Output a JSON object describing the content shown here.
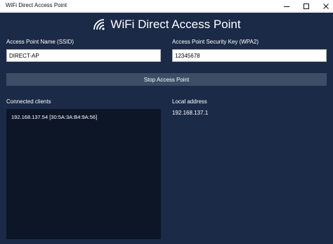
{
  "window": {
    "title": "WiFi Direct Access Point",
    "controls": [
      "minimize-icon",
      "maximize-icon",
      "close-icon"
    ]
  },
  "app": {
    "heading": "WiFi Direct Access Point",
    "heading_icon": "wifi-icon",
    "ssid": {
      "label": "Access Point Name (SSID)",
      "value": "DIRECT-AP"
    },
    "key": {
      "label": "Access Point Security Key (WPA2)",
      "value": "12345678"
    },
    "stop_button": "Stop Access Point",
    "clients": {
      "label": "Connected clients",
      "items": [
        "192.168.137.54 [30:5A:3A:B4:9A:56]"
      ]
    },
    "local": {
      "label": "Local address",
      "value": "192.168.137.1"
    }
  },
  "colors": {
    "background": "#1b2a47",
    "button": "#3c4e66",
    "list_background": "#0d1626",
    "text": "#ffffff"
  }
}
